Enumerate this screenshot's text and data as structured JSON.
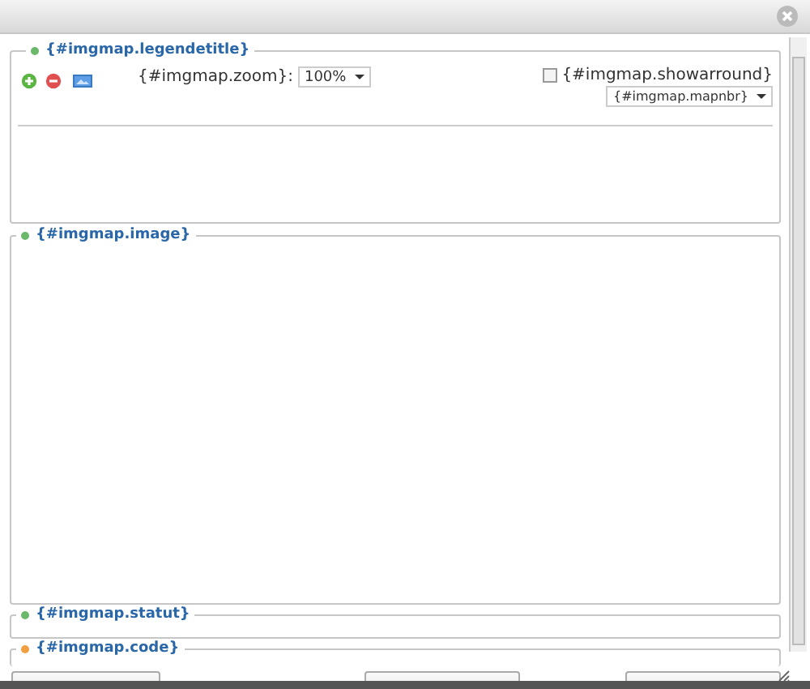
{
  "legend": {
    "title": "{#imgmap.legendetitle}",
    "zoom_label": "{#imgmap.zoom}:",
    "zoom_value": "100%",
    "showarround": {
      "label": "{#imgmap.showarround}",
      "checked": false
    },
    "mapnbr": "{#imgmap.mapnbr}"
  },
  "image": {
    "title": "{#imgmap.image}"
  },
  "statut": {
    "title": "{#imgmap.statut}"
  },
  "code": {
    "title": "{#imgmap.code}"
  },
  "buttons": [
    {
      "kind": "left"
    },
    {
      "kind": "right"
    },
    {
      "kind": "right"
    }
  ]
}
